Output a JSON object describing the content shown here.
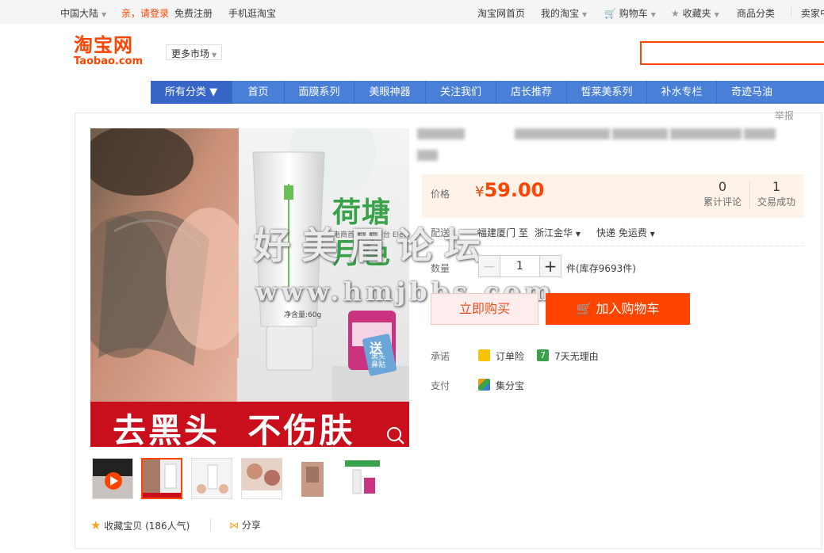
{
  "topbar": {
    "region": "中国大陆",
    "login": "亲，请登录",
    "register": "免费注册",
    "mobile": "手机逛淘宝",
    "home": "淘宝网首页",
    "my": "我的淘宝",
    "cart": "购物车",
    "fav": "收藏夹",
    "category": "商品分类",
    "seller": "卖家中"
  },
  "header": {
    "logo_cn": "淘宝网",
    "logo_en": "Taobao.com",
    "more_market": "更多市场"
  },
  "nav": {
    "items": [
      "所有分类",
      "首页",
      "面膜系列",
      "美眼神器",
      "关注我们",
      "店长推荐",
      "皙莱美系列",
      "补水专栏",
      "奇迹马油"
    ]
  },
  "product": {
    "report": "举报",
    "banner_text": "去黑头  不伤肤",
    "brand_text": "荷塘月色",
    "brand_sub": "电商首选互动平台 Electric preferred platform",
    "tube_text": "净含量:60g",
    "gift_text": "送",
    "gift_sub": "黑头鼻贴",
    "watermark_1": "好美眉论坛",
    "watermark_2": "www.hmjbbs.com",
    "price_label": "价格",
    "price_currency": "¥",
    "price_value": "59.00",
    "reviews_count": "0",
    "reviews_label": "累计评论",
    "deals_count": "1",
    "deals_label": "交易成功",
    "shipping_label": "配送",
    "shipping_from": "福建厦门 至",
    "shipping_to": "浙江金华",
    "shipping_method": "快递 免运费",
    "qty_label": "数量",
    "qty_minus": "−",
    "qty_value": "1",
    "qty_plus": "+",
    "stock": "件(库存9693件)",
    "buy_now": "立即购买",
    "add_cart": "加入购物车",
    "promise_label": "承诺",
    "promise_1": "订单险",
    "promise_2": "7天无理由",
    "promise_2_badge": "7",
    "pay_label": "支付",
    "pay_1": "集分宝",
    "favorite": "收藏宝贝 (186人气)",
    "share": "分享"
  },
  "colors": {
    "accent": "#ff4400",
    "nav": "#4a7fd8",
    "price_bg": "#fff2e8"
  }
}
